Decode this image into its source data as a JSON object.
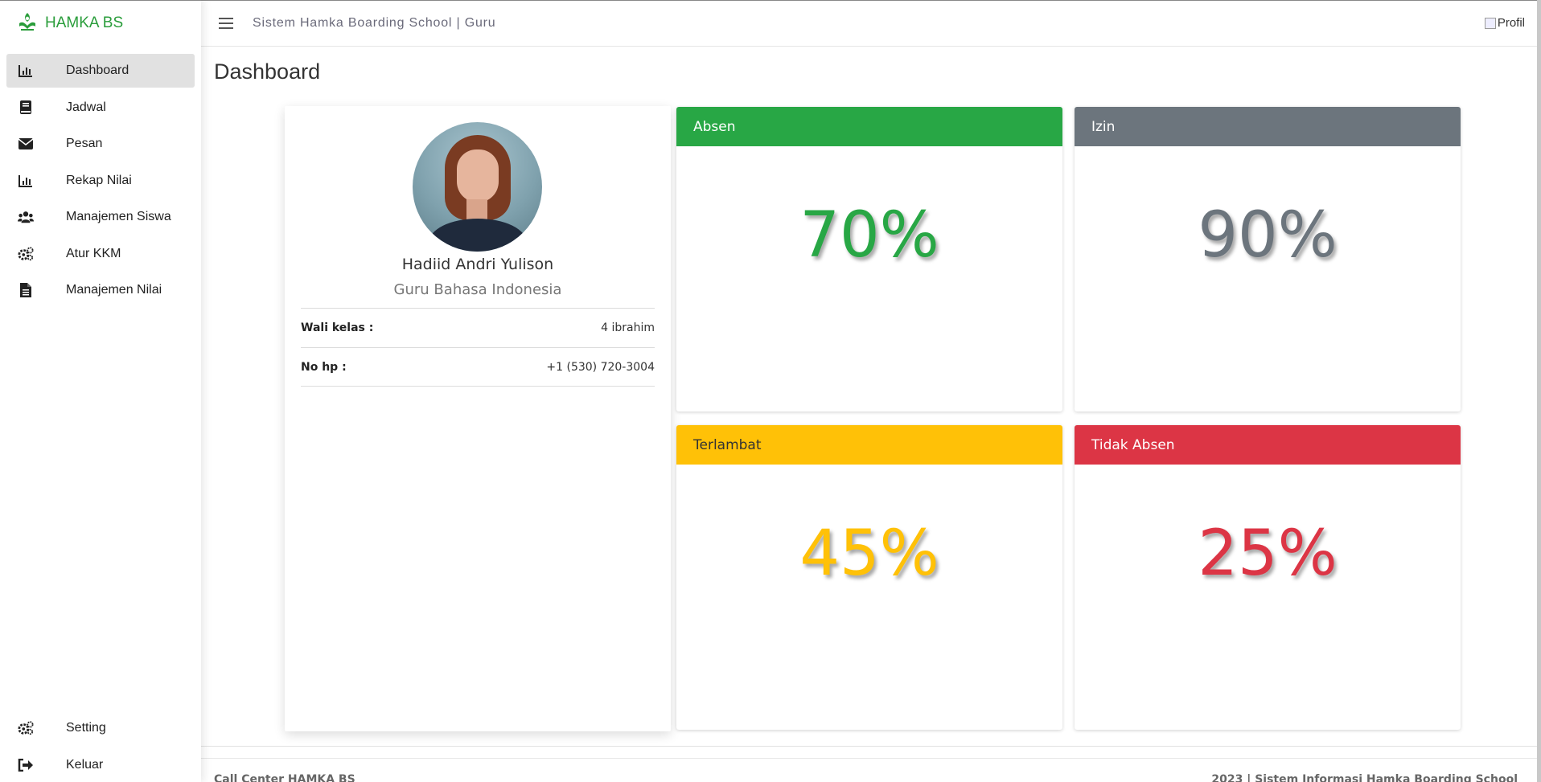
{
  "brand": {
    "name": "HAMKA BS"
  },
  "topbar": {
    "title": "Sistem Hamka Boarding School | Guru",
    "profile_alt": "Profil"
  },
  "sidebar": {
    "items": [
      {
        "label": "Dashboard",
        "icon": "chart-bar-icon",
        "active": true
      },
      {
        "label": "Jadwal",
        "icon": "book-icon"
      },
      {
        "label": "Pesan",
        "icon": "envelope-icon"
      },
      {
        "label": "Rekap Nilai",
        "icon": "chart-bar-icon"
      },
      {
        "label": "Manajemen Siswa",
        "icon": "users-icon"
      },
      {
        "label": "Atur KKM",
        "icon": "cogs-icon"
      },
      {
        "label": "Manajemen Nilai",
        "icon": "file-icon"
      }
    ],
    "bottom": [
      {
        "label": "Setting",
        "icon": "cogs-icon"
      },
      {
        "label": "Keluar",
        "icon": "sign-out-icon"
      }
    ]
  },
  "main": {
    "title": "Dashboard"
  },
  "profile": {
    "name": "Hadiid Andri Yulison",
    "role": "Guru Bahasa Indonesia",
    "rows": [
      {
        "key": "Wali kelas :",
        "value": "4 ibrahim"
      },
      {
        "key": "No hp :",
        "value": "+1 (530) 720-3004"
      }
    ]
  },
  "stats": [
    {
      "title": "Absen",
      "value": "70%",
      "color": "#28a745"
    },
    {
      "title": "Izin",
      "value": "90%",
      "color": "#6c757d"
    },
    {
      "title": "Terlambat",
      "value": "45%",
      "color": "#ffc107"
    },
    {
      "title": "Tidak Absen",
      "value": "25%",
      "color": "#dc3545"
    }
  ],
  "footer": {
    "left": "Call Center HAMKA BS",
    "right": "2023 | Sistem Informasi Hamka Boarding School"
  }
}
